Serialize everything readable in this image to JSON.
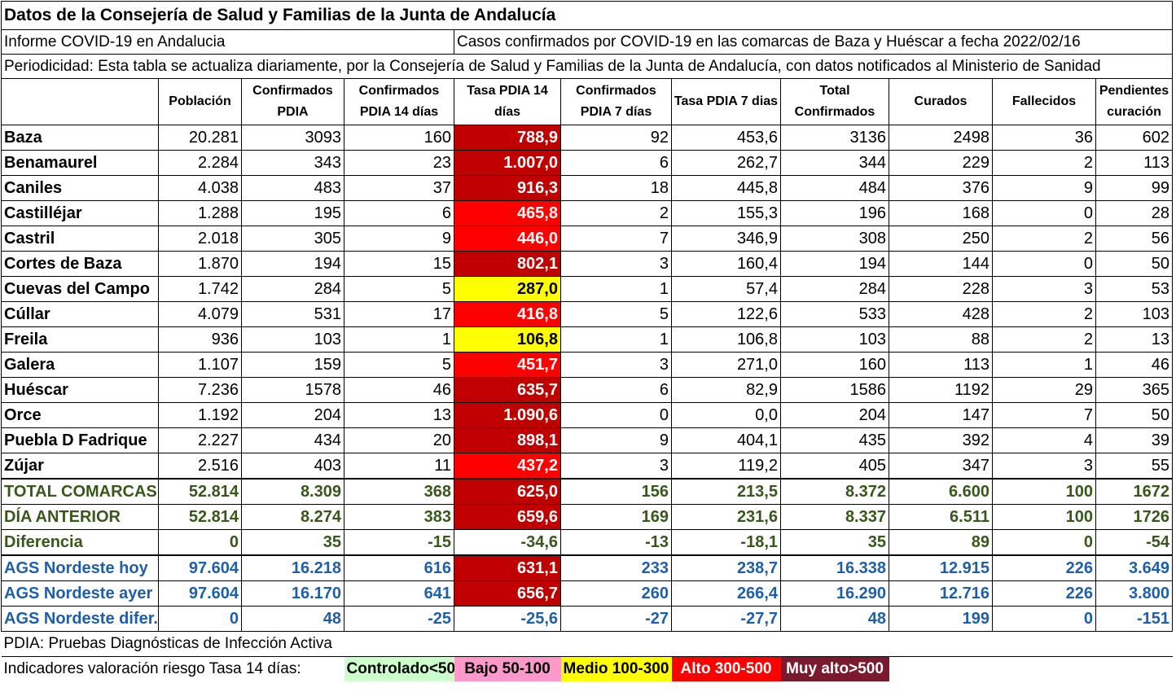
{
  "title": "Datos de la Consejería de Salud y Familias de la Junta de Andalucía",
  "info_left": "Informe COVID-19 en Andalucia",
  "info_right": "Casos confirmados por COVID-19 en las comarcas de Baza y Huéscar a fecha 2022/02/16",
  "periodicity": "Periodicidad: Esta tabla se actualiza diariamente, por la Consejería de Salud y Familias de la Junta de Andalucía, con datos notificados al Ministerio de Sanidad",
  "headers": [
    "",
    "Población",
    "Confirmados PDIA",
    "Confirmados PDIA 14 días",
    "Tasa PDIA 14 días",
    "Confirmados PDIA 7 días",
    "Tasa PDIA 7 dias",
    "Total Confirmados",
    "Curados",
    "Fallecidos",
    "Pendientes curación"
  ],
  "rows": [
    {
      "name": "Baza",
      "cells": [
        "20.281",
        "3093",
        "160",
        "788,9",
        "92",
        "453,6",
        "3136",
        "2498",
        "36",
        "602"
      ],
      "level": "dark"
    },
    {
      "name": "Benamaurel",
      "cells": [
        "2.284",
        "343",
        "23",
        "1.007,0",
        "6",
        "262,7",
        "344",
        "229",
        "2",
        "113"
      ],
      "level": "dark"
    },
    {
      "name": "Caniles",
      "cells": [
        "4.038",
        "483",
        "37",
        "916,3",
        "18",
        "445,8",
        "484",
        "376",
        "9",
        "99"
      ],
      "level": "dark"
    },
    {
      "name": "Castilléjar",
      "cells": [
        "1.288",
        "195",
        "6",
        "465,8",
        "2",
        "155,3",
        "196",
        "168",
        "0",
        "28"
      ],
      "level": "red"
    },
    {
      "name": "Castril",
      "cells": [
        "2.018",
        "305",
        "9",
        "446,0",
        "7",
        "346,9",
        "308",
        "250",
        "2",
        "56"
      ],
      "level": "red"
    },
    {
      "name": "Cortes de Baza",
      "cells": [
        "1.870",
        "194",
        "15",
        "802,1",
        "3",
        "160,4",
        "194",
        "144",
        "0",
        "50"
      ],
      "level": "dark"
    },
    {
      "name": "Cuevas del Campo",
      "cells": [
        "1.742",
        "284",
        "5",
        "287,0",
        "1",
        "57,4",
        "284",
        "228",
        "3",
        "53"
      ],
      "level": "yellow"
    },
    {
      "name": "Cúllar",
      "cells": [
        "4.079",
        "531",
        "17",
        "416,8",
        "5",
        "122,6",
        "533",
        "428",
        "2",
        "103"
      ],
      "level": "red"
    },
    {
      "name": "Freila",
      "cells": [
        "936",
        "103",
        "1",
        "106,8",
        "1",
        "106,8",
        "103",
        "88",
        "2",
        "13"
      ],
      "level": "yellow"
    },
    {
      "name": "Galera",
      "cells": [
        "1.107",
        "159",
        "5",
        "451,7",
        "3",
        "271,0",
        "160",
        "113",
        "1",
        "46"
      ],
      "level": "red"
    },
    {
      "name": "Huéscar",
      "cells": [
        "7.236",
        "1578",
        "46",
        "635,7",
        "6",
        "82,9",
        "1586",
        "1192",
        "29",
        "365"
      ],
      "level": "dark"
    },
    {
      "name": "Orce",
      "cells": [
        "1.192",
        "204",
        "13",
        "1.090,6",
        "0",
        "0,0",
        "204",
        "147",
        "7",
        "50"
      ],
      "level": "dark"
    },
    {
      "name": "Puebla D Fadrique",
      "cells": [
        "2.227",
        "434",
        "20",
        "898,1",
        "9",
        "404,1",
        "435",
        "392",
        "4",
        "39"
      ],
      "level": "dark"
    },
    {
      "name": "Zújar",
      "cells": [
        "2.516",
        "403",
        "11",
        "437,2",
        "3",
        "119,2",
        "405",
        "347",
        "3",
        "55"
      ],
      "level": "red"
    }
  ],
  "summary_rows": [
    {
      "name": "TOTAL COMARCAS",
      "cells": [
        "52.814",
        "8.309",
        "368",
        "625,0",
        "156",
        "213,5",
        "8.372",
        "6.600",
        "100",
        "1672"
      ],
      "level": "dark"
    },
    {
      "name": "DÍA ANTERIOR",
      "cells": [
        "52.814",
        "8.274",
        "383",
        "659,6",
        "169",
        "231,6",
        "8.337",
        "6.511",
        "100",
        "1726"
      ],
      "level": "dark"
    },
    {
      "name": "Diferencia",
      "cells": [
        "0",
        "35",
        "-15",
        "-34,6",
        "-13",
        "-18,1",
        "35",
        "89",
        "0",
        "-54"
      ],
      "level": "none"
    }
  ],
  "ags_rows": [
    {
      "name": "AGS Nordeste hoy",
      "cells": [
        "97.604",
        "16.218",
        "616",
        "631,1",
        "233",
        "238,7",
        "16.338",
        "12.915",
        "226",
        "3.649"
      ],
      "level": "dark"
    },
    {
      "name": "AGS Nordeste ayer",
      "cells": [
        "97.604",
        "16.170",
        "641",
        "656,7",
        "260",
        "266,4",
        "16.290",
        "12.716",
        "226",
        "3.800"
      ],
      "level": "dark"
    },
    {
      "name": "AGS Nordeste difer.",
      "cells": [
        "0",
        "48",
        "-25",
        "-25,6",
        "-27",
        "-27,7",
        "48",
        "199",
        "0",
        "-151"
      ],
      "level": "none"
    }
  ],
  "footnote": "PDIA: Pruebas Diagnósticas de Infección Activa",
  "legend_label": "Indicadores valoración riesgo Tasa 14 días:",
  "legend": [
    {
      "label": "Controlado<50",
      "color": "#ccffcc"
    },
    {
      "label": "Bajo 50-100",
      "color": "#ff99cc"
    },
    {
      "label": "Medio 100-300",
      "color": "#ffff00"
    },
    {
      "label": "Alto 300-500",
      "color": "#ff0000"
    },
    {
      "label": "Muy alto>500",
      "color": "#7b1a2e"
    }
  ]
}
